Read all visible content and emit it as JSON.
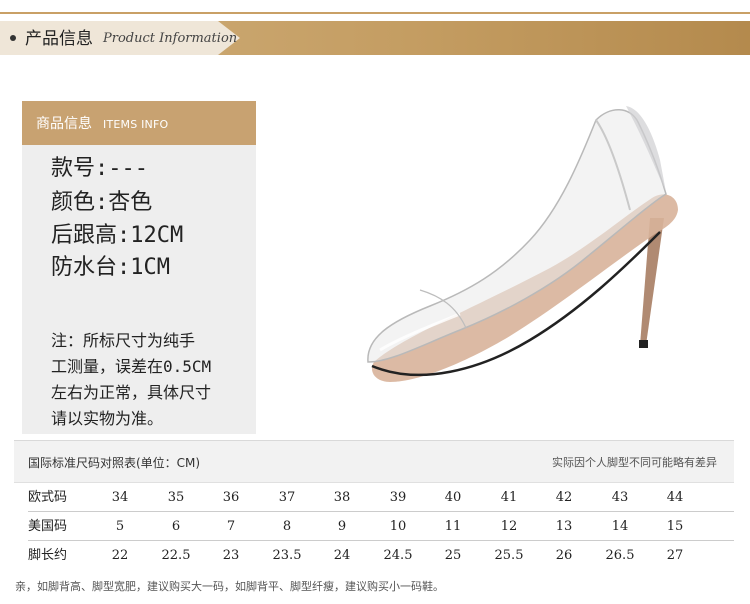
{
  "header": {
    "title_cn": "产品信息",
    "title_en": "Product Information"
  },
  "info_panel": {
    "label_cn": "商品信息",
    "label_en": "ITEMS INFO",
    "specs": [
      "款号:---",
      "颜色:杏色",
      "后跟高:12CM",
      "防水台:1CM"
    ],
    "note_lines": [
      "注：所标尺寸为纯手",
      "工测量，误差在0.5CM",
      "左右为正常，具体尺寸",
      "请以实物为准。"
    ]
  },
  "size_table": {
    "title": "国际标准尺码对照表(单位：CM)",
    "remark": "实际因个人脚型不同可能略有差异",
    "rows": [
      {
        "label": "欧式码",
        "values": [
          "34",
          "35",
          "36",
          "37",
          "38",
          "39",
          "40",
          "41",
          "42",
          "43",
          "44"
        ]
      },
      {
        "label": "美国码",
        "values": [
          "5",
          "6",
          "7",
          "8",
          "9",
          "10",
          "11",
          "12",
          "13",
          "14",
          "15"
        ]
      },
      {
        "label": "脚长约",
        "values": [
          "22",
          "22.5",
          "23",
          "23.5",
          "24",
          "24.5",
          "25",
          "25.5",
          "26",
          "26.5",
          "27"
        ]
      }
    ]
  },
  "footnote": "亲，如脚背高、脚型宽肥，建议购买大一码，如脚背平、脚型纤瘦，建议购买小一码鞋。",
  "colors": {
    "accent": "#c8a271",
    "header_bar": "#c49d62",
    "panel_bg": "#eeeeee"
  },
  "illustration": {
    "icon": "transparent-pointed-heel-shoe-image"
  }
}
